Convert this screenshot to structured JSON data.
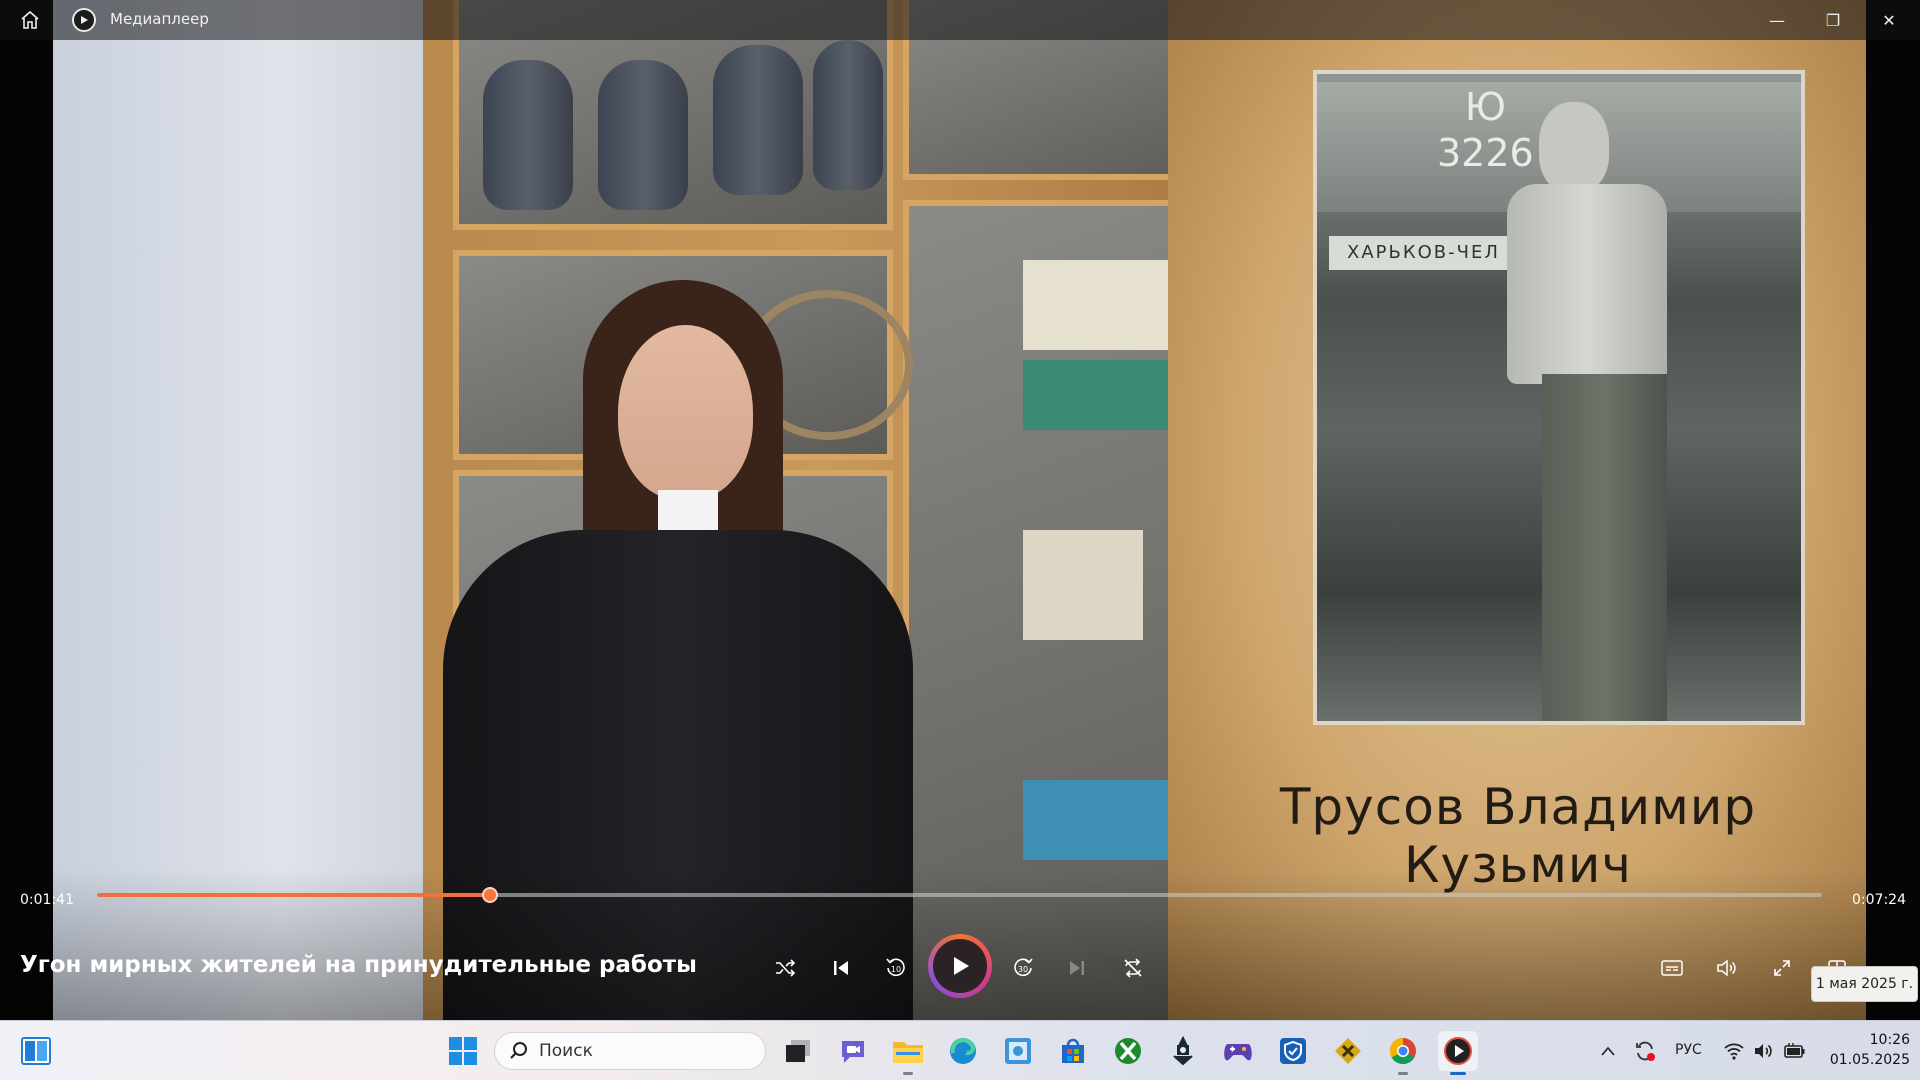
{
  "window": {
    "app_title": "Медиаплеер",
    "home_icon": "home-icon",
    "app_icon": "media-player-icon",
    "controls": {
      "minimize": "—",
      "maximize": "❐",
      "close": "✕"
    }
  },
  "video_frame": {
    "train_number_line1": "Ю",
    "train_number_line2": "3226",
    "route_sign": "ХАРЬКОВ-ЧЕЛ",
    "caption": "Трусов Владимир Кузьмич"
  },
  "player": {
    "elapsed": "0:01:41",
    "total": "0:07:24",
    "progress_fraction": 0.228,
    "title": "Угон мирных жителей на принудительные работы",
    "buttons": [
      "shuffle-icon",
      "previous-icon",
      "skip-back-10-icon",
      "play-icon",
      "skip-forward-30-icon",
      "next-icon",
      "repeat-icon",
      "subtitles-icon",
      "volume-icon",
      "fullscreen-icon",
      "miniplayer-icon"
    ],
    "accent_color": "#f0713a",
    "tooltip": "1 мая 2025 г."
  },
  "taskbar": {
    "search_placeholder": "Поиск",
    "apps": [
      "start-icon",
      "task-view-icon",
      "teams-icon",
      "file-explorer-icon",
      "edge-icon",
      "control-panel-icon",
      "store-icon",
      "xbox-icon",
      "steam-icon",
      "gamepad-icon",
      "security-icon",
      "app-icon",
      "chrome-icon",
      "media-player-icon"
    ],
    "language": "РУС",
    "time": "10:26",
    "date": "01.05.2025"
  }
}
